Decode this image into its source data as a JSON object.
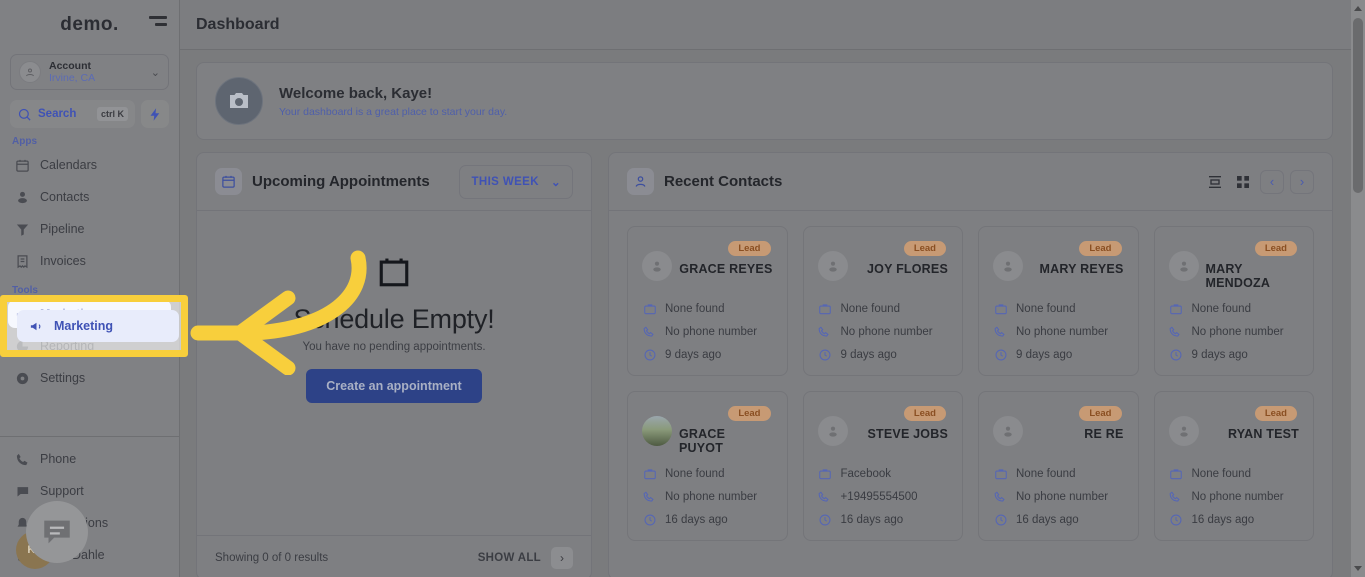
{
  "colors": {
    "accent": "#3f52b5",
    "highlight": "#f8cf3c",
    "badge_bg": "#c79a74",
    "badge_text": "#8a4f22",
    "primary_button": "#2d4287"
  },
  "sidebar": {
    "brand": "demo.",
    "collapse_icon": "collapse-menu-icon",
    "account": {
      "name": "Account",
      "location": "Irvine, CA",
      "avatar_icon": "account-avatar-icon",
      "chevron_icon": "chevron-down-icon"
    },
    "search": {
      "label": "Search",
      "shortcut": "ctrl K",
      "icon": "search-icon"
    },
    "quick_action_icon": "lightning-bolt-icon",
    "sections": [
      {
        "label": "Apps"
      },
      {
        "label": "Tools"
      }
    ],
    "apps_label": "Apps",
    "tools_label": "Tools",
    "items_apps": [
      {
        "label": "Calendars",
        "icon": "calendar-icon"
      },
      {
        "label": "Contacts",
        "icon": "contacts-person-icon"
      },
      {
        "label": "Pipeline",
        "icon": "pipeline-funnel-icon"
      },
      {
        "label": "Invoices",
        "icon": "invoice-document-icon"
      }
    ],
    "items_tools": [
      {
        "label": "Marketing",
        "icon": "megaphone-icon",
        "active": true
      },
      {
        "label": "Reporting",
        "icon": "pie-chart-icon",
        "active": false
      },
      {
        "label": "Settings",
        "icon": "gear-icon",
        "active": false
      }
    ],
    "items_bottom": [
      {
        "label": "Phone",
        "icon": "phone-icon"
      },
      {
        "label": "Support",
        "icon": "support-chat-icon"
      },
      {
        "label": "Notifications",
        "icon": "bell-icon"
      },
      {
        "label": "Kaye Dahle",
        "icon": "user-profile-icon"
      }
    ],
    "chat_widget_icon": "chat-bubble-icon",
    "user_initials": "KS"
  },
  "topbar": {
    "title": "Dashboard"
  },
  "welcome": {
    "icon": "camera-avatar-icon",
    "title": "Welcome back, Kaye!",
    "subtitle": "Your dashboard is a great place to start your day."
  },
  "appointments": {
    "icon": "calendar-icon",
    "title": "Upcoming Appointments",
    "range_label": "THIS WEEK",
    "range_chevron_icon": "chevron-down-icon",
    "empty_icon": "calendar-empty-icon",
    "empty_title": "Schedule Empty!",
    "empty_subtitle": "You have no pending appointments.",
    "create_button": "Create an appointment",
    "footer_results": "Showing 0 of 0 results",
    "footer_show_all": "SHOW ALL",
    "footer_next_icon": "chevron-right-icon"
  },
  "recent_contacts": {
    "icon": "person-icon",
    "title": "Recent Contacts",
    "list_view_icon": "list-view-icon",
    "grid_view_icon": "grid-view-icon",
    "prev_icon": "chevron-left-icon",
    "next_icon": "chevron-right-icon",
    "field_icons": {
      "company": "briefcase-icon",
      "phone": "phone-ring-icon",
      "time": "clock-icon"
    },
    "cards": [
      {
        "badge": "Lead",
        "name": "GRACE REYES",
        "company": "None found",
        "phone": "No phone number",
        "time": "9 days ago",
        "avatar": "placeholder"
      },
      {
        "badge": "Lead",
        "name": "JOY FLORES",
        "company": "None found",
        "phone": "No phone number",
        "time": "9 days ago",
        "avatar": "placeholder"
      },
      {
        "badge": "Lead",
        "name": "MARY REYES",
        "company": "None found",
        "phone": "No phone number",
        "time": "9 days ago",
        "avatar": "placeholder"
      },
      {
        "badge": "Lead",
        "name": "MARY MENDOZA",
        "company": "None found",
        "phone": "No phone number",
        "time": "9 days ago",
        "avatar": "placeholder"
      },
      {
        "badge": "Lead",
        "name": "GRACE PUYOT",
        "company": "None found",
        "phone": "No phone number",
        "time": "16 days ago",
        "avatar": "photo"
      },
      {
        "badge": "Lead",
        "name": "STEVE JOBS",
        "company": "Facebook",
        "phone": "+19495554500",
        "time": "16 days ago",
        "avatar": "placeholder"
      },
      {
        "badge": "Lead",
        "name": "RE RE",
        "company": "None found",
        "phone": "No phone number",
        "time": "16 days ago",
        "avatar": "placeholder"
      },
      {
        "badge": "Lead",
        "name": "RYAN TEST",
        "company": "None found",
        "phone": "No phone number",
        "time": "16 days ago",
        "avatar": "placeholder"
      }
    ]
  },
  "annotation": {
    "arrow_icon": "curved-arrow-pointing-left",
    "highlight_target": "Marketing"
  }
}
